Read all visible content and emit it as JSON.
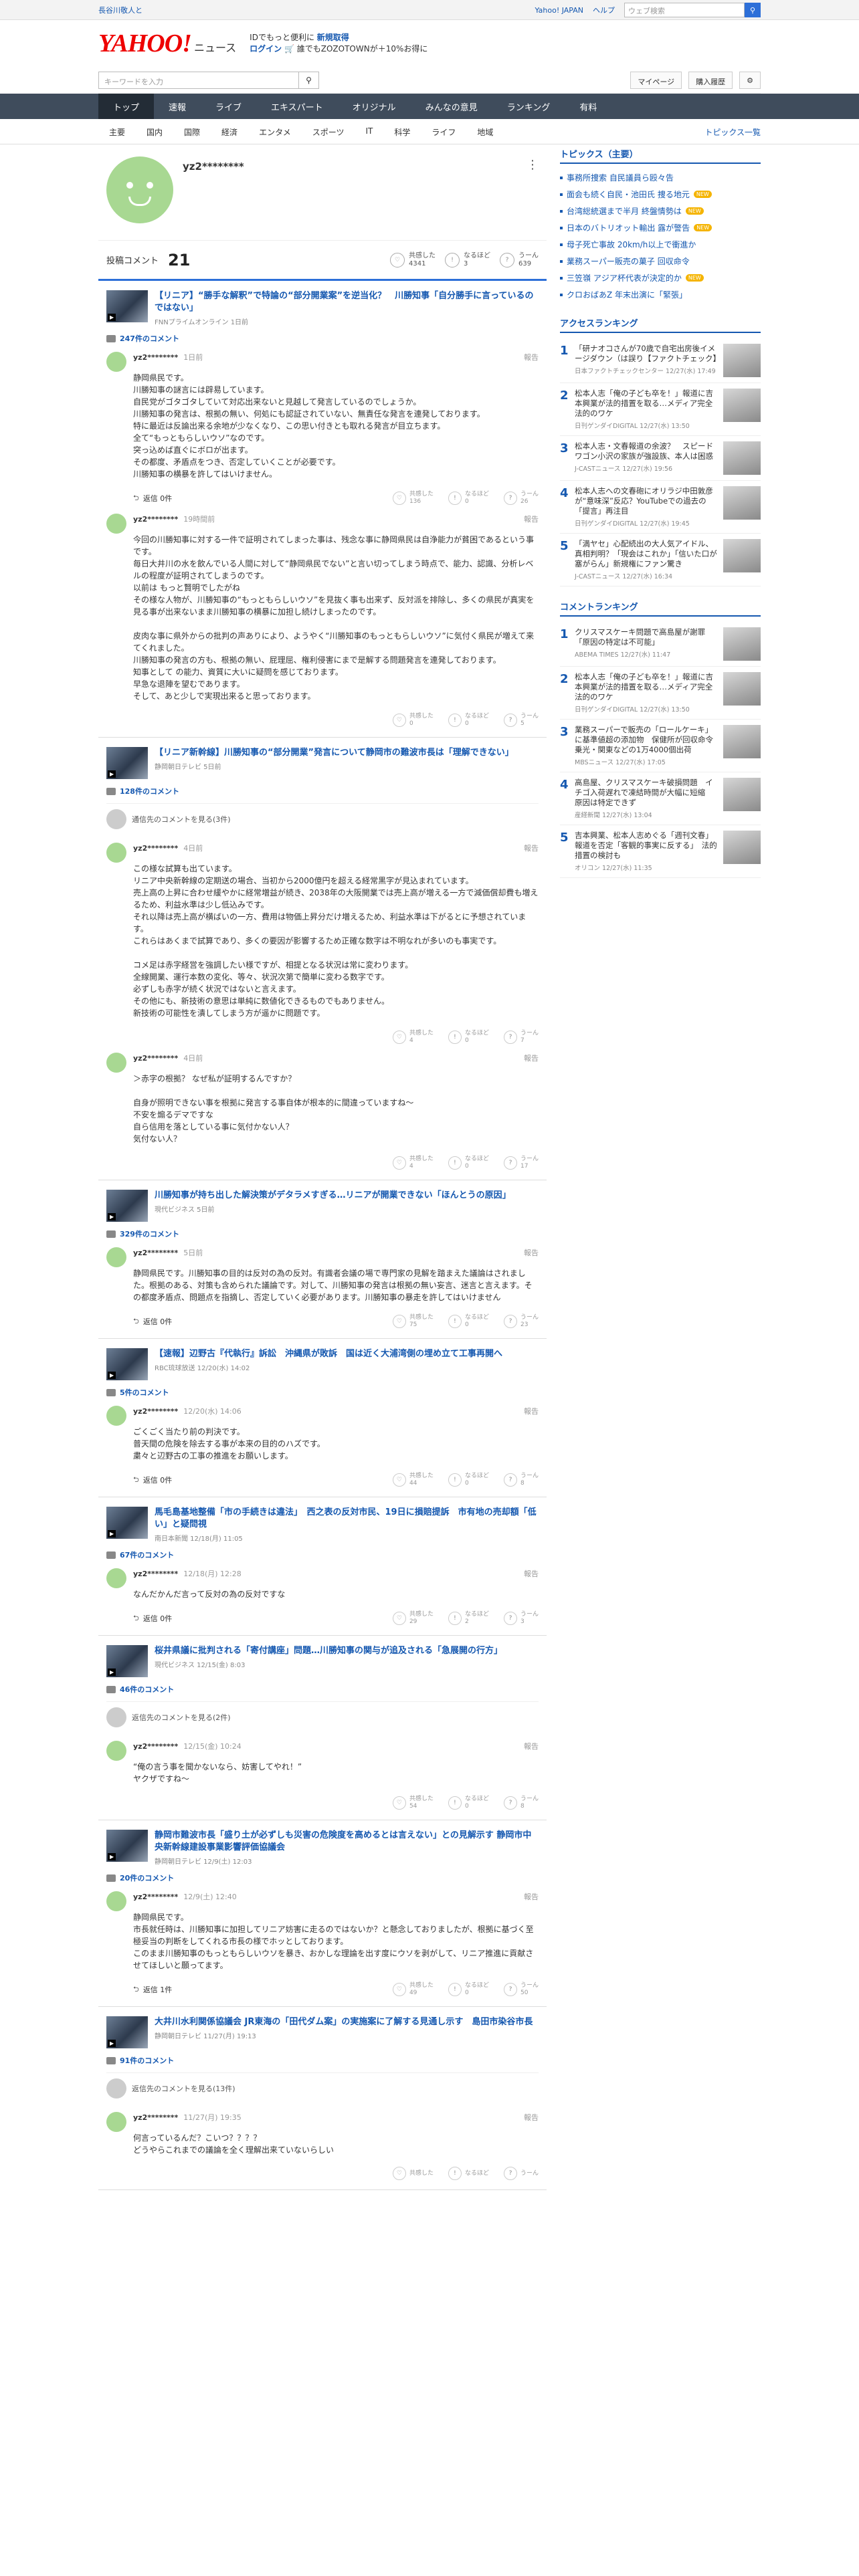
{
  "topbar": {
    "notice": "長谷川敬人と",
    "links": [
      "Yahoo! JAPAN",
      "ヘルプ"
    ],
    "search_placeholder": "ウェブ検索"
  },
  "header": {
    "logo": "YAHOO!",
    "logo_sub": "ニュース",
    "promo1": "IDでもっと便利に",
    "promo1b": "新規取得",
    "promo2a": "ログイン",
    "promo2b": "誰でもZOZOTOWNが＋10%お得に"
  },
  "subbar": {
    "keyword_placeholder": "キーワードを入力",
    "mypage": "マイページ",
    "purchase": "購入履歴"
  },
  "nav": [
    "トップ",
    "速報",
    "ライブ",
    "エキスパート",
    "オリジナル",
    "みんなの意見",
    "ランキング",
    "有料"
  ],
  "cats": [
    "主要",
    "国内",
    "国際",
    "経済",
    "エンタメ",
    "スポーツ",
    "IT",
    "科学",
    "ライフ",
    "地域"
  ],
  "cats_right": "トピックス一覧",
  "profile": {
    "name": "yz2********"
  },
  "stats": {
    "label": "投稿コメント",
    "count": "21",
    "reactions": [
      {
        "label": "共感した",
        "value": "4341"
      },
      {
        "label": "なるほど",
        "value": "3"
      },
      {
        "label": "うーん",
        "value": "639"
      }
    ]
  },
  "articles": [
    {
      "title": "【リニア】“勝手な解釈”で特論の“部分開業案”を逆当化？　川勝知事「自分勝手に言っているのではない」",
      "source": "FNNプライムオンライン 1日前",
      "count": "247件のコメント",
      "comments": [
        {
          "user": "yz2********",
          "time": "1日前",
          "text": "静岡県民です。\n川勝知事の謎言には辟易しています。\n自民党がゴタゴタしていて対応出来ないと見越して発言しているのでしょうか。\n川勝知事の発言は、根拠の無い、何処にも認証されていない、無責任な発言を連発しております。\n特に最近は反論出来る余地が少なくなり、この思い付きとも取れる発言が目立ちます。\n全て“もっともらしいウソ”なのです。\n突っ込めば直ぐにボロが出ます。\nその都度、矛盾点をつき、否定していくことが必要です。\n川勝知事の横暴を許してはいけません。",
          "replies": "返信 0件",
          "votes": [
            "136",
            "0",
            "26"
          ]
        },
        {
          "user": "yz2********",
          "time": "19時間前",
          "text": "今回の川勝知事に対する一件で証明されてしまった事は、残念な事に静岡県民は自浄能力が貧困であるという事です。\n毎日大井川の水を飲んでいる人間に対して“静岡県民でない”と言い切ってしまう時点で、能力、認識、分析レベルの程度が証明されてしまうのです。\n以前は もっと賢明でしたがね\nその様な人物が、川勝知事の“もっともらしいウソ”を見抜く事も出来ず、反対派を排除し、多くの県民が真実を見る事が出来ないまま川勝知事の横暴に加担し続けしまったのです。\n\n皮肉な事に県外からの批判の声ありにより、ようやく“川勝知事のもっともらしいウソ”に気付く県民が増えて来てくれました。\n川勝知事の発言の方も、根拠の無い、屁理屈、権利侵害にまで是解する問題発言を連発しております。\n知事として の能力、資質に大いに疑問を感じております。\n早急な退陣を望むであります。\nそして、あと少しで実現出来ると思っております。",
          "replies": "",
          "votes": [
            "0",
            "0",
            "5"
          ]
        }
      ]
    },
    {
      "title": "【リニア新幹線】川勝知事の“部分開業”発言について静岡市の難波市長は「理解できない」",
      "source": "静岡朝日テレビ 5日前",
      "count": "128件のコメント",
      "hidden": "通信先のコメントを見る(3件)",
      "comments": [
        {
          "user": "yz2********",
          "time": "4日前",
          "text": "この様な試算も出ています。\nリニア中央新幹線の定期送の場合、当初から2000億円を超える経常黒字が見込まれています。\n売上高の上昇に合わせ緩やかに経常増益が続き、2038年の大阪開業では売上高が増える一方で減価償却費も増えるため、利益水準は少し低込みです。\nそれ以降は売上高が横ばいの一方、費用は物価上昇分だけ増えるため、利益水準は下がるとに予想されています。\nこれらはあくまで試算であり、多くの要因が影響するため正確な数字は不明なれが多いのも事実です。\n\nコメ足は赤字経営を強調したい様ですが、相提となる状況は常に変わります。\n全線開業、運行本数の変化、等々、状況次第で簡単に変わる数字です。\n必ずしも赤字が続く状況ではないと言えます。\nその他にも、新技術の意思は単純に数値化できるものでもありません。\n新技術の可能性を潰してしまう方が遥かに問題です。",
          "replies": "",
          "votes": [
            "4",
            "0",
            "7"
          ]
        },
        {
          "user": "yz2********",
          "time": "4日前",
          "text": "＞赤字の根拠？ なぜ私が証明するんですか？\n\n自身が照明できない事を根拠に発言する事自体が根本的に間違っていますね〜\n不安を煽るデマですな\n自ら信用を落としている事に気付かない人？\n気付ない人？",
          "replies": "",
          "votes": [
            "4",
            "0",
            "17"
          ]
        }
      ]
    },
    {
      "title": "川勝知事が持ち出した解決策がデタラメすぎる…リニアが開業できない「ほんとうの原因」",
      "source": "現代ビジネス 5日前",
      "count": "329件のコメント",
      "comments": [
        {
          "user": "yz2********",
          "time": "5日前",
          "text": "静岡県民です。川勝知事の目的は反対の為の反対。有識者会議の場で専門家の見解を踏まえた議論はされました。根拠のある、対策も含められた議論です。対して、川勝知事の発言は根拠の無い妄言、迷言と言えます。その都度矛盾点、問題点を指摘し、否定していく必要があります。川勝知事の暴走を許してはいけません",
          "replies": "返信 0件",
          "votes": [
            "75",
            "0",
            "23"
          ]
        }
      ]
    },
    {
      "title": "【速報】辺野古『代執行』訴訟　沖縄県が敗訴　国は近く大浦湾側の埋め立て工事再開へ",
      "source": "RBC琉球放送 12/20(水) 14:02",
      "count": "5件のコメント",
      "comments": [
        {
          "user": "yz2********",
          "time": "12/20(水) 14:06",
          "text": "ごくごく当たり前の判決です。\n普天間の危険を除去する事が本来の目的のハズです。\n粛々と辺野古の工事の推進をお願いします。",
          "replies": "返信 0件",
          "votes": [
            "44",
            "0",
            "8"
          ]
        }
      ]
    },
    {
      "title": "馬毛島基地整備「市の手続きは違法」　西之表の反対市民、19日に損賠提訴　市有地の売却額「低い」と疑問視",
      "source": "南日本新聞 12/18(月) 11:05",
      "count": "67件のコメント",
      "comments": [
        {
          "user": "yz2********",
          "time": "12/18(月) 12:28",
          "text": "なんだかんだ言って反対の為の反対ですな",
          "replies": "返信 0件",
          "votes": [
            "29",
            "2",
            "3"
          ]
        }
      ]
    },
    {
      "title": "桜井県議に批判される「寄付講座」問題…川勝知事の関与が追及される「急展開の行方」",
      "source": "現代ビジネス 12/15(金) 8:03",
      "count": "46件のコメント",
      "hidden": "返信先のコメントを見る(2件)",
      "comments": [
        {
          "user": "yz2********",
          "time": "12/15(金) 10:24",
          "text": "“俺の言う事を聞かないなら、妨害してやれ！”\nヤクザですね〜",
          "replies": "",
          "votes": [
            "54",
            "0",
            "8"
          ]
        }
      ]
    },
    {
      "title": "静岡市難波市長「盛り土が必ずしも災害の危険度を高めるとは言えない」との見解示す 静岡市中央新幹線建設事業影響評価協議会",
      "source": "静岡朝日テレビ 12/9(土) 12:03",
      "count": "20件のコメント",
      "comments": [
        {
          "user": "yz2********",
          "time": "12/9(土) 12:40",
          "text": "静岡県民です。\n市長就任時は、川勝知事に加担してリニア妨害に走るのではないか？と懸念しておりましたが、根拠に基づく至極妥当の判断をしてくれる市長の様でホッとしております。\nこのまま川勝知事のもっともらしいウソを暴き、おかしな理論を出す度にウソを剥がして、リニア推進に貢献させてほしいと願ってます。",
          "replies": "返信 1件",
          "votes": [
            "49",
            "0",
            "50"
          ]
        }
      ]
    },
    {
      "title": "大井川水利関係協議会 JR東海の「田代ダム案」の実施案に了解する見通し示す　島田市染谷市長",
      "source": "静岡朝日テレビ 11/27(月) 19:13",
      "count": "91件のコメント",
      "hidden": "返信先のコメントを見る(13件)",
      "comments": [
        {
          "user": "yz2********",
          "time": "11/27(月) 19:35",
          "text": "何言っているんだ？こいつ？？？？\nどうやらこれまでの議論を全く理解出来ていないらしい",
          "replies": "",
          "votes": [
            "",
            "",
            ""
          ]
        }
      ]
    }
  ],
  "sidebar": {
    "topics_title": "トピックス（主要）",
    "topics": [
      {
        "t": "事務所捜索 自民議員ら殴々告",
        "n": false
      },
      {
        "t": "面会も続く自民・池田氏 捜る地元",
        "n": true
      },
      {
        "t": "台湾総統選まで半月 終盤情勢は",
        "n": true
      },
      {
        "t": "日本のバトリオット輸出 露が警告",
        "n": true
      },
      {
        "t": "母子死亡事故 20km/h以上で衝進か",
        "n": false
      },
      {
        "t": "業務スーパー販売の菓子 回収命令",
        "n": false
      },
      {
        "t": "三笠嶺 アジア杯代表が決定的か",
        "n": true
      },
      {
        "t": "クロおばあZ 年末出演に「緊張」",
        "n": false
      }
    ],
    "access_title": "アクセスランキング",
    "access": [
      {
        "t": "「研ナオコさんが70歳で自宅出房後イメージダウン（は誤り【ファクトチェック】",
        "s": "日本ファクトチェックセンター 12/27(水) 17:49"
      },
      {
        "t": "松本人志「俺の子ども卒を！」報道に吉本興業が法的措置を取る…メディア完全法的のワケ",
        "s": "日刊ゲンダイDIGITAL 12/27(水) 13:50"
      },
      {
        "t": "松本人志・文春報道の余波？　スピードワゴン小沢の家族が強設族、本人は困惑",
        "s": "J-CASTニュース 12/27(水) 19:56"
      },
      {
        "t": "松本人志への文春砲にオリラジ中田敦彦が“意味深”反応？YouTubeでの過去の「提言」再注目",
        "s": "日刊ゲンダイDIGITAL 12/27(水) 19:45"
      },
      {
        "t": "「満ヤセ」心配続出の大人気アイドル、真相判明？「現会はこれか」「信いた口が塞がらん」新規権にファン驚き",
        "s": "J-CASTニュース 12/27(水) 16:34"
      }
    ],
    "comment_title": "コメントランキング",
    "commentrank": [
      {
        "t": "クリスマスケーキ問題で高島屋が謝罪「原因の特定は不可能」",
        "s": "ABEMA TIMES 12/27(水) 11:47"
      },
      {
        "t": "松本人志「俺の子ども卒を！」報道に吉本興業が法的措置を取る…メディア完全法的のワケ",
        "s": "日刊ゲンダイDIGITAL 12/27(水) 13:50"
      },
      {
        "t": "業務スーパーで販売の「ロールケーキ」に基準値超の添加物　保健所が回収命令　乗光・関東などの1万4000個出荷",
        "s": "MBSニュース 12/27(水) 17:05"
      },
      {
        "t": "高島屋、クリスマスケーキ破損問題　イチゴ入荷遅れで凍結時間が大幅に短縮　原因は特定できず",
        "s": "産経新聞 12/27(水) 13:04"
      },
      {
        "t": "吉本興業、松本人志めぐる「週刊文春」報道を否定「客観的事実に反する」　法的措置の検討も",
        "s": "オリコン 12/27(水) 11:35"
      }
    ]
  }
}
